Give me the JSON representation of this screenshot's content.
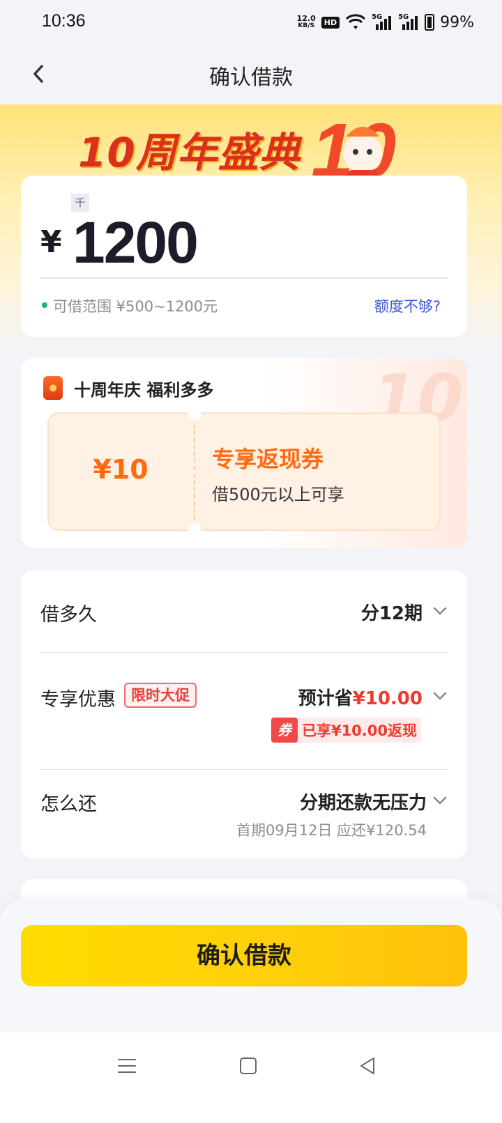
{
  "status_bar": {
    "time": "10:36",
    "net_speed_value": "12.0",
    "net_speed_unit": "KB/S",
    "hd": "HD",
    "signal_1": "5G",
    "signal_2": "5G",
    "battery": "99%"
  },
  "nav": {
    "title": "确认借款"
  },
  "banner": {
    "title": "10周年盛典",
    "emblem_text": "10"
  },
  "amount": {
    "unit_tag": "千",
    "currency": "¥",
    "value": "1200",
    "range_text": "可借范围 ¥500~1200元",
    "quota_link": "额度不够?"
  },
  "promo": {
    "title": "十周年庆 福利多多",
    "bg_text": "10",
    "coupon_amount": "¥10",
    "coupon_name": "专享返现券",
    "coupon_desc": "借500元以上可享"
  },
  "details": {
    "term_label": "借多久",
    "term_value": "分12期",
    "discount_label": "专享优惠",
    "discount_tag": "限时大促",
    "discount_prefix": "预计省",
    "discount_amount": "¥10.00",
    "cashback_icon": "券",
    "cashback_text": "已享¥10.00返现",
    "repay_label": "怎么还",
    "repay_value": "分期还款无压力",
    "first_repay": "首期09月12日 应还¥120.54"
  },
  "footer": {
    "confirm_label": "确认借款"
  },
  "colors": {
    "accent_yellow": "#ffd400",
    "link_blue": "#3a56d4",
    "coupon_orange": "#ff6a12",
    "promo_red": "#f03a2e"
  }
}
